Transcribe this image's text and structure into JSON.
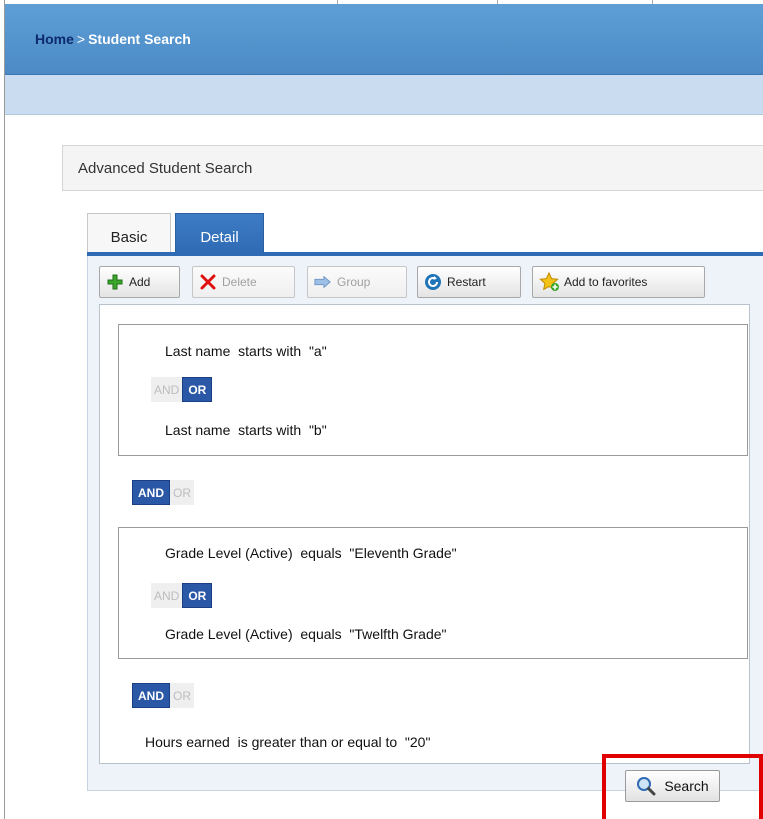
{
  "breadcrumb": {
    "home": "Home",
    "separator": ">",
    "current": "Student Search"
  },
  "advanced": {
    "title": "Advanced Student Search"
  },
  "tabs": [
    {
      "label": "Basic",
      "active": false
    },
    {
      "label": "Detail",
      "active": true
    }
  ],
  "toolbar": {
    "add": {
      "label": "Add",
      "icon": "plus-icon",
      "enabled": true
    },
    "delete": {
      "label": "Delete",
      "icon": "delete-x-icon",
      "enabled": false
    },
    "group": {
      "label": "Group",
      "icon": "group-arrow-icon",
      "enabled": false
    },
    "restart": {
      "label": "Restart",
      "icon": "restart-icon",
      "enabled": true
    },
    "favorites": {
      "label": "Add to favorites",
      "icon": "star-add-icon",
      "enabled": true
    }
  },
  "rules": {
    "group1": {
      "cond1": "Last name  starts with  \"a\"",
      "operator": {
        "and": "AND",
        "or": "OR",
        "selected": "OR"
      },
      "cond2": "Last name  starts with  \"b\""
    },
    "join1": {
      "and": "AND",
      "or": "OR",
      "selected": "AND"
    },
    "group2": {
      "cond1": "Grade Level (Active)  equals  \"Eleventh Grade\"",
      "operator": {
        "and": "AND",
        "or": "OR",
        "selected": "OR"
      },
      "cond2": "Grade Level (Active)  equals  \"Twelfth Grade\""
    },
    "join2": {
      "and": "AND",
      "or": "OR",
      "selected": "AND"
    },
    "cond3": "Hours earned  is greater than or equal to  \"20\""
  },
  "search_button": {
    "label": "Search",
    "icon": "magnifier-icon"
  },
  "colors": {
    "header_blue": "#4b8ac6",
    "selected_operator": "#2a57a6",
    "highlight_red": "#e00000"
  }
}
